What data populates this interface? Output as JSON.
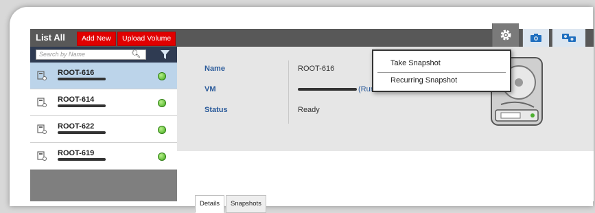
{
  "header": {
    "title": "List All",
    "add_new": "Add New",
    "upload_volume": "Upload Volume",
    "icons": [
      "gear-icon",
      "camera-icon",
      "snapshots-icon"
    ],
    "accent_red": "#e00000"
  },
  "search": {
    "placeholder": "Search by Name"
  },
  "volumes": [
    {
      "name": "ROOT-616",
      "status": "green",
      "selected": true
    },
    {
      "name": "ROOT-614",
      "status": "green",
      "selected": false
    },
    {
      "name": "ROOT-622",
      "status": "green",
      "selected": false
    },
    {
      "name": "ROOT-619",
      "status": "green",
      "selected": false
    }
  ],
  "details": {
    "name_label": "Name",
    "name_value": "ROOT-616",
    "vm_label": "VM",
    "vm_suffix": "(Runnin",
    "status_label": "Status",
    "status_value": "Ready"
  },
  "menu": {
    "take_snapshot": "Take Snapshot",
    "recurring_snapshot": "Recurring Snapshot"
  },
  "tabs": [
    "Details",
    "Snapshots"
  ]
}
